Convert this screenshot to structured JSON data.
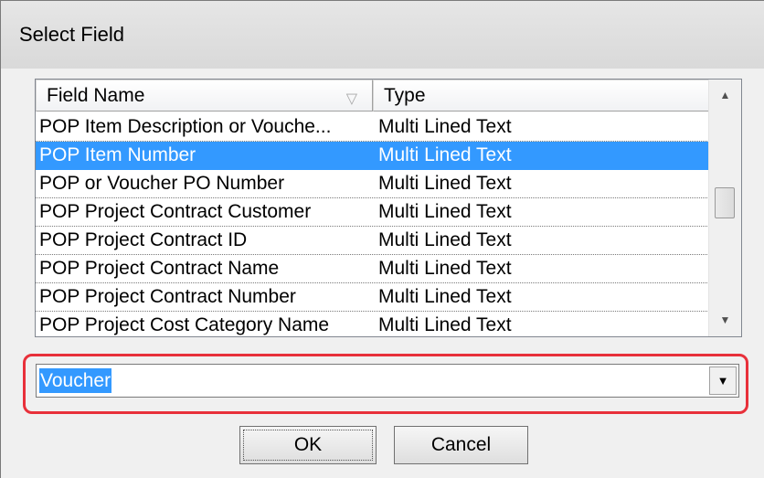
{
  "window": {
    "title": "Select Field"
  },
  "list": {
    "columns": [
      "Field Name",
      "Type"
    ],
    "sort_icon": "sort-filter-icon",
    "rows": [
      {
        "name": "POP Item Description or Vouche...",
        "type": "Multi Lined Text",
        "selected": false
      },
      {
        "name": "POP Item Number",
        "type": "Multi Lined Text",
        "selected": true
      },
      {
        "name": "POP or Voucher PO Number",
        "type": "Multi Lined Text",
        "selected": false
      },
      {
        "name": "POP Project Contract Customer",
        "type": "Multi Lined Text",
        "selected": false
      },
      {
        "name": "POP Project Contract ID",
        "type": "Multi Lined Text",
        "selected": false
      },
      {
        "name": "POP Project Contract Name",
        "type": "Multi Lined Text",
        "selected": false
      },
      {
        "name": "POP Project Contract Number",
        "type": "Multi Lined Text",
        "selected": false
      },
      {
        "name": "POP Project Cost Category Name",
        "type": "Multi Lined Text",
        "selected": false
      }
    ]
  },
  "search": {
    "value": "Voucher",
    "dropdown_icon": "chevron-down-icon"
  },
  "buttons": {
    "ok_label": "OK",
    "cancel_label": "Cancel"
  },
  "colors": {
    "selection": "#3399ff",
    "highlight_outline": "#e8303a"
  }
}
